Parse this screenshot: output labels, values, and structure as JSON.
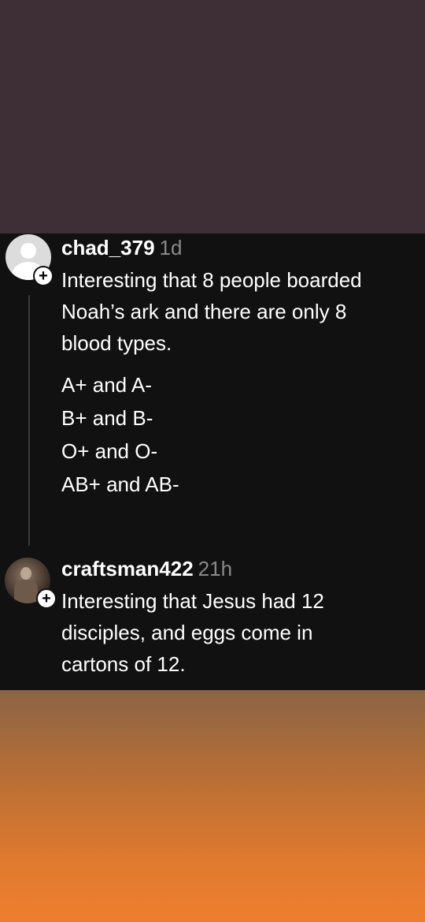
{
  "posts": [
    {
      "username": "chad_379",
      "timestamp": "1d",
      "body_lines": [
        "Interesting that 8 people boarded",
        "Noah’s ark and there are only 8",
        "blood types."
      ],
      "list_lines": [
        "A+ and A-",
        "B+ and B-",
        "O+ and O-",
        "AB+ and AB-"
      ],
      "follow_glyph": "+"
    },
    {
      "username": "craftsman422",
      "timestamp": "21h",
      "body_lines": [
        "Interesting that Jesus had 12",
        "disciples, and eggs come in",
        "cartons of 12."
      ],
      "follow_glyph": "+"
    }
  ],
  "colors": {
    "top_background": "#3d2f35",
    "card_background": "#111111",
    "bottom_gradient": [
      "#8b6446",
      "#ee7e2f"
    ],
    "timestamp": "#8a8a8a"
  },
  "icons": {
    "avatar_1": "default-user-avatar-icon",
    "avatar_2": "profile-photo-avatar",
    "follow": "plus-icon"
  }
}
